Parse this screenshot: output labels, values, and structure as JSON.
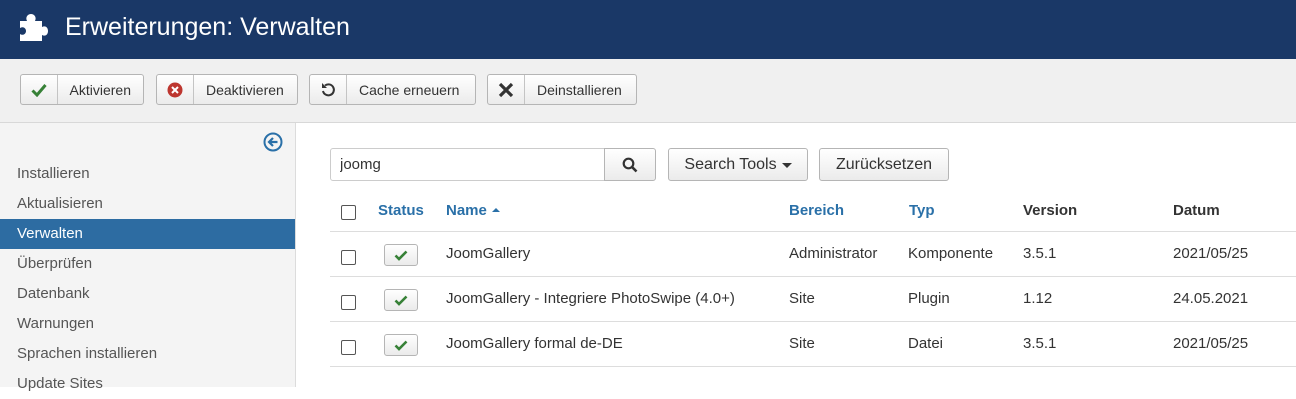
{
  "header": {
    "title": "Erweiterungen: Verwalten",
    "icon": "puzzle-icon"
  },
  "toolbar": {
    "buttons": [
      {
        "label": "Aktivieren",
        "icon": "check-icon"
      },
      {
        "label": "Deaktivieren",
        "icon": "disable-icon"
      },
      {
        "label": "Cache erneuern",
        "icon": "refresh-icon"
      },
      {
        "label": "Deinstallieren",
        "icon": "uninstall-icon"
      }
    ]
  },
  "sidebar": {
    "items": [
      {
        "label": "Installieren",
        "active": false
      },
      {
        "label": "Aktualisieren",
        "active": false
      },
      {
        "label": "Verwalten",
        "active": true
      },
      {
        "label": "Überprüfen",
        "active": false
      },
      {
        "label": "Datenbank",
        "active": false
      },
      {
        "label": "Warnungen",
        "active": false
      },
      {
        "label": "Sprachen installieren",
        "active": false
      },
      {
        "label": "Update Sites",
        "active": false
      }
    ]
  },
  "filter": {
    "search_value": "joomg",
    "search_tools_label": "Search Tools",
    "reset_label": "Zurücksetzen"
  },
  "table": {
    "columns": {
      "status": "Status",
      "name": "Name",
      "bereich": "Bereich",
      "typ": "Typ",
      "version": "Version",
      "datum": "Datum"
    },
    "rows": [
      {
        "name": "JoomGallery",
        "bereich": "Administrator",
        "typ": "Komponente",
        "version": "3.5.1",
        "datum": "2021/05/25",
        "enabled": true
      },
      {
        "name": "JoomGallery - Integriere PhotoSwipe (4.0+)",
        "bereich": "Site",
        "typ": "Plugin",
        "version": "1.12",
        "datum": "24.05.2021",
        "enabled": true
      },
      {
        "name": "JoomGallery formal de-DE",
        "bereich": "Site",
        "typ": "Datei",
        "version": "3.5.1",
        "datum": "2021/05/25",
        "enabled": true
      }
    ]
  },
  "colors": {
    "header_bg": "#1a3867",
    "active_sidebar": "#2d6ca2",
    "link": "#2a70a8",
    "success": "#378137",
    "danger": "#bd362f"
  }
}
